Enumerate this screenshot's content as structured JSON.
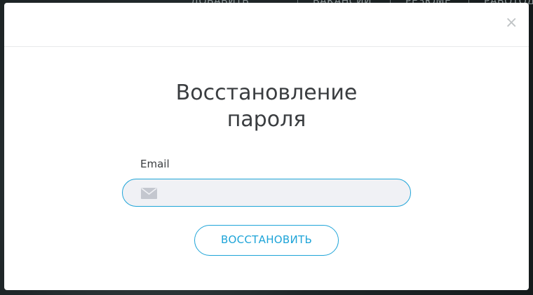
{
  "background_nav": {
    "items": [
      "ДОБАВИТЬ",
      "ВАКАНСИИ",
      "РЕЗЮМЕ",
      "РАБОТОДАТЕЛИ"
    ]
  },
  "modal": {
    "close_label": "×",
    "title_line1": "Восстановление",
    "title_line2": "пароля",
    "email": {
      "label": "Email",
      "value": "",
      "placeholder": ""
    },
    "submit_label": "ВОССТАНОВИТЬ"
  },
  "colors": {
    "accent": "#1ea4d8",
    "input_background": "#f0f1f5",
    "title_text": "#3a3d40",
    "icon_gray": "#c4c7cf",
    "close_gray": "#c0c4c6"
  },
  "icons": {
    "email_field": "envelope-icon",
    "close": "close-icon"
  }
}
